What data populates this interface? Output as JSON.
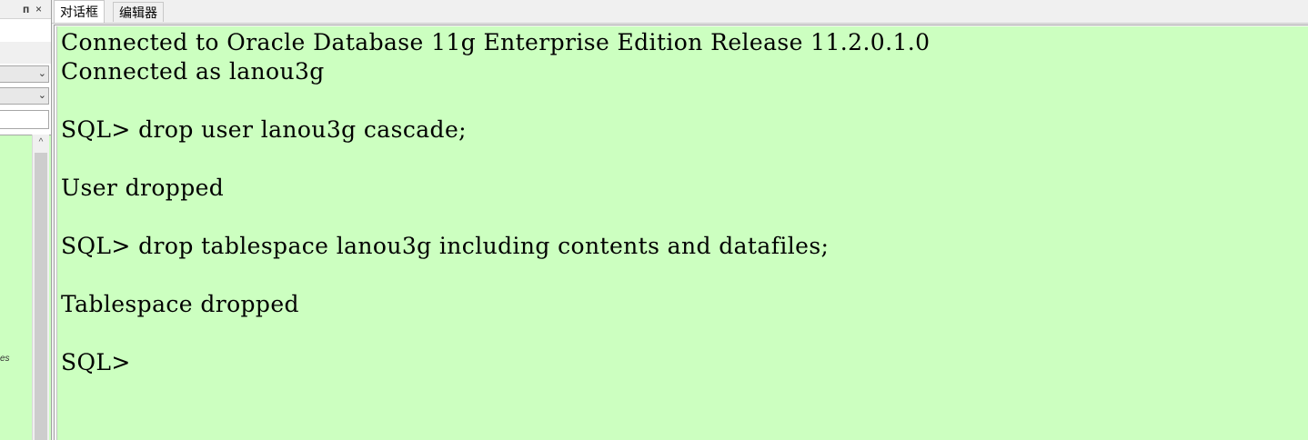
{
  "tabs": [
    {
      "label": "对话框",
      "active": true
    },
    {
      "label": "编辑器",
      "active": false
    }
  ],
  "left_panel": {
    "pin_glyph": "ᴨ",
    "close_glyph": "×",
    "tree_item_label": "es",
    "dropdown_chevron": "⌄",
    "scroll_up_glyph": "^"
  },
  "console": {
    "background": "#ccffc0",
    "lines": [
      "Connected to Oracle Database 11g Enterprise Edition Release 11.2.0.1.0",
      "Connected as lanou3g",
      "",
      "SQL> drop user lanou3g cascade;",
      "",
      "User dropped",
      "",
      "SQL> drop tablespace lanou3g including contents and datafiles;",
      "",
      "Tablespace dropped",
      "",
      "SQL>"
    ]
  }
}
